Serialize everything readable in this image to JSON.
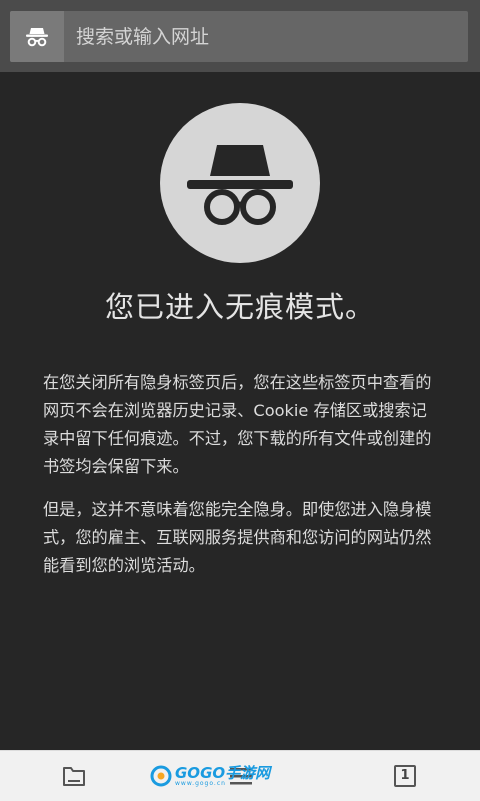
{
  "toolbar": {
    "url_placeholder": "搜索或输入网址",
    "incognito_icon": "incognito-icon"
  },
  "main": {
    "heading": "您已进入无痕模式。",
    "paragraph1": "在您关闭所有隐身标签页后，您在这些标签页中查看的网页不会在浏览器历史记录、Cookie 存储区或搜索记录中留下任何痕迹。不过，您下载的所有文件或创建的书签均会保留下来。",
    "paragraph2": "但是，这并不意味着您能完全隐身。即使您进入隐身模式，您的雇主、互联网服务提供商和您访问的网站仍然能看到您的浏览活动。"
  },
  "bottom_bar": {
    "tab_count": "1",
    "items": [
      "folder-icon",
      "menu-icon",
      "tabs-icon"
    ]
  },
  "watermark": {
    "text": "GOGO手游网",
    "subtext": "www.gogo.cn"
  },
  "colors": {
    "background": "#262626",
    "toolbar": "#4b4b4b",
    "urlbox": "#666666",
    "bottom_bar": "#f1f1f1",
    "watermark": "#1a9be0"
  }
}
